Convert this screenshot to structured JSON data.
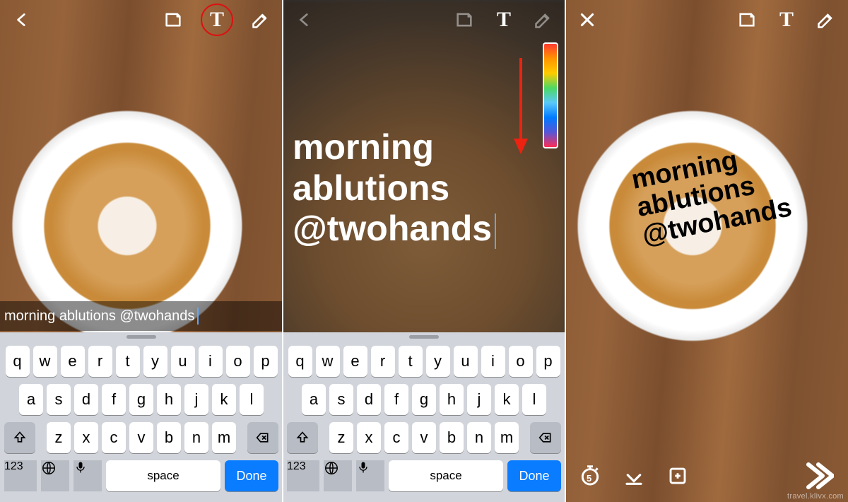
{
  "caption_text": "morning ablutions @twohands",
  "big_text_lines": [
    "morning",
    "ablutions",
    "@twohands"
  ],
  "overlay_text_lines": [
    "morning",
    "ablutions",
    "@twohands"
  ],
  "timer_value": "5",
  "watermark": "travel.klivx.com",
  "keyboard": {
    "row1": [
      "q",
      "w",
      "e",
      "r",
      "t",
      "y",
      "u",
      "i",
      "o",
      "p"
    ],
    "row2": [
      "a",
      "s",
      "d",
      "f",
      "g",
      "h",
      "j",
      "k",
      "l"
    ],
    "row3": [
      "z",
      "x",
      "c",
      "v",
      "b",
      "n",
      "m"
    ],
    "numbers_label": "123",
    "space_label": "space",
    "done_label": "Done"
  }
}
